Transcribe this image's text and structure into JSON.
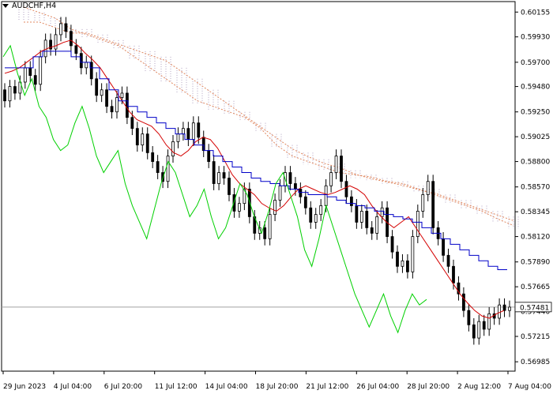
{
  "chart_data": {
    "type": "candlestick",
    "symbol": "AUDCHF,H4",
    "y_range": [
      0.569,
      0.6025
    ],
    "y_ticks": [
      "0.60155",
      "0.59930",
      "0.59700",
      "0.59480",
      "0.59250",
      "0.59025",
      "0.58800",
      "0.58570",
      "0.58345",
      "0.58120",
      "0.57890",
      "0.57665",
      "0.57440",
      "0.57215",
      "0.56985"
    ],
    "current_price": "0.57481",
    "x_labels": [
      "29 Jun 2023",
      "4 Jul 04:00",
      "6 Jul 20:00",
      "11 Jul 12:00",
      "14 Jul 04:00",
      "18 Jul 20:00",
      "21 Jul 12:00",
      "26 Jul 04:00",
      "28 Jul 20:00",
      "2 Aug 12:00",
      "7 Aug 04:00"
    ],
    "candles_close": [
      0.5935,
      0.5948,
      0.5942,
      0.5952,
      0.5965,
      0.5958,
      0.595,
      0.5975,
      0.599,
      0.5982,
      0.5995,
      0.6005,
      0.5998,
      0.5985,
      0.5978,
      0.5965,
      0.597,
      0.5955,
      0.594,
      0.5945,
      0.593,
      0.5925,
      0.5938,
      0.5942,
      0.592,
      0.591,
      0.5895,
      0.5905,
      0.5888,
      0.588,
      0.587,
      0.5862,
      0.5885,
      0.5898,
      0.5905,
      0.591,
      0.59,
      0.5915,
      0.5902,
      0.589,
      0.588,
      0.586,
      0.587,
      0.5865,
      0.585,
      0.5835,
      0.5842,
      0.5855,
      0.583,
      0.5815,
      0.582,
      0.581,
      0.5832,
      0.5845,
      0.5858,
      0.587,
      0.586,
      0.5855,
      0.5848,
      0.5838,
      0.5825,
      0.5832,
      0.584,
      0.5858,
      0.587,
      0.5885,
      0.5862,
      0.5848,
      0.584,
      0.5825,
      0.5835,
      0.582,
      0.5815,
      0.583,
      0.5838,
      0.5812,
      0.5798,
      0.5785,
      0.579,
      0.578,
      0.5812,
      0.5835,
      0.585,
      0.5862,
      0.582,
      0.581,
      0.5795,
      0.5785,
      0.577,
      0.576,
      0.5745,
      0.5732,
      0.572,
      0.5735,
      0.5728,
      0.5742,
      0.5738,
      0.575,
      0.5745,
      0.5748
    ],
    "tenkan_sen": [
      0.596,
      0.5962,
      0.5965,
      0.597,
      0.5975,
      0.598,
      0.5983,
      0.5985,
      0.5988,
      0.599,
      0.5985,
      0.5978,
      0.5972,
      0.5965,
      0.5955,
      0.5945,
      0.5935,
      0.5925,
      0.5918,
      0.5915,
      0.5912,
      0.5905,
      0.5895,
      0.5888,
      0.5885,
      0.589,
      0.5898,
      0.5902,
      0.59,
      0.5892,
      0.588,
      0.5868,
      0.586,
      0.5855,
      0.585,
      0.5842,
      0.5838,
      0.5835,
      0.584,
      0.5848,
      0.5855,
      0.5858,
      0.5855,
      0.5852,
      0.585,
      0.5852,
      0.5855,
      0.5858,
      0.5855,
      0.585,
      0.584,
      0.5832,
      0.5825,
      0.582,
      0.5825,
      0.583,
      0.582,
      0.581,
      0.58,
      0.579,
      0.578,
      0.577,
      0.576,
      0.5752,
      0.5745,
      0.574,
      0.5738,
      0.5742,
      0.5745
    ],
    "kijun_sen": [
      0.5965,
      0.5965,
      0.5965,
      0.5975,
      0.598,
      0.598,
      0.598,
      0.5975,
      0.597,
      0.5965,
      0.5955,
      0.5945,
      0.5935,
      0.593,
      0.5925,
      0.592,
      0.5915,
      0.591,
      0.5905,
      0.59,
      0.5895,
      0.589,
      0.5885,
      0.588,
      0.5875,
      0.587,
      0.5865,
      0.5862,
      0.586,
      0.5858,
      0.5855,
      0.5852,
      0.585,
      0.585,
      0.5848,
      0.5845,
      0.5842,
      0.584,
      0.5838,
      0.5835,
      0.5832,
      0.583,
      0.5828,
      0.5825,
      0.582,
      0.5815,
      0.581,
      0.5805,
      0.58,
      0.5795,
      0.579,
      0.5785,
      0.5782,
      0.5782
    ],
    "chikou_span": [
      0.5975,
      0.5985,
      0.596,
      0.594,
      0.5955,
      0.593,
      0.592,
      0.59,
      0.589,
      0.5895,
      0.5915,
      0.593,
      0.591,
      0.5885,
      0.587,
      0.588,
      0.589,
      0.586,
      0.584,
      0.5825,
      0.581,
      0.5835,
      0.586,
      0.588,
      0.587,
      0.585,
      0.583,
      0.584,
      0.5855,
      0.583,
      0.581,
      0.582,
      0.584,
      0.586,
      0.585,
      0.583,
      0.5815,
      0.5835,
      0.586,
      0.587,
      0.585,
      0.583,
      0.58,
      0.5785,
      0.581,
      0.584,
      0.582,
      0.58,
      0.578,
      0.576,
      0.5745,
      0.573,
      0.5745,
      0.576,
      0.574,
      0.5725,
      0.5745,
      0.576,
      0.575,
      0.5755
    ],
    "senkou_a": [
      0.602,
      0.6015,
      0.601,
      0.6,
      0.5995,
      0.599,
      0.5985,
      0.5975,
      0.5965,
      0.5955,
      0.5945,
      0.5935,
      0.593,
      0.5925,
      0.592,
      0.591,
      0.5895,
      0.5885,
      0.588,
      0.5875,
      0.587,
      0.5868,
      0.5866,
      0.5862,
      0.586,
      0.5855,
      0.585,
      0.5845,
      0.584,
      0.5835,
      0.5828,
      0.5822
    ],
    "senkou_b": [
      0.601,
      0.601,
      0.6005,
      0.6,
      0.6,
      0.5995,
      0.599,
      0.5985,
      0.598,
      0.5975,
      0.5965,
      0.5955,
      0.5945,
      0.5935,
      0.5925,
      0.5915,
      0.5905,
      0.5895,
      0.5888,
      0.5882,
      0.5878,
      0.5872,
      0.5868,
      0.5865,
      0.5862,
      0.5858,
      0.5855,
      0.585,
      0.5845,
      0.584,
      0.5835,
      0.583
    ],
    "colors": {
      "background": "#ffffff",
      "candle": "#000000",
      "tenkan_sen": "#d40000",
      "kijun_sen": "#0000c8",
      "chikou_span": "#00d000",
      "cloud_a": "#e08860",
      "cloud_b": "#b0a0c0",
      "price_line": "#a0a0a0"
    }
  }
}
